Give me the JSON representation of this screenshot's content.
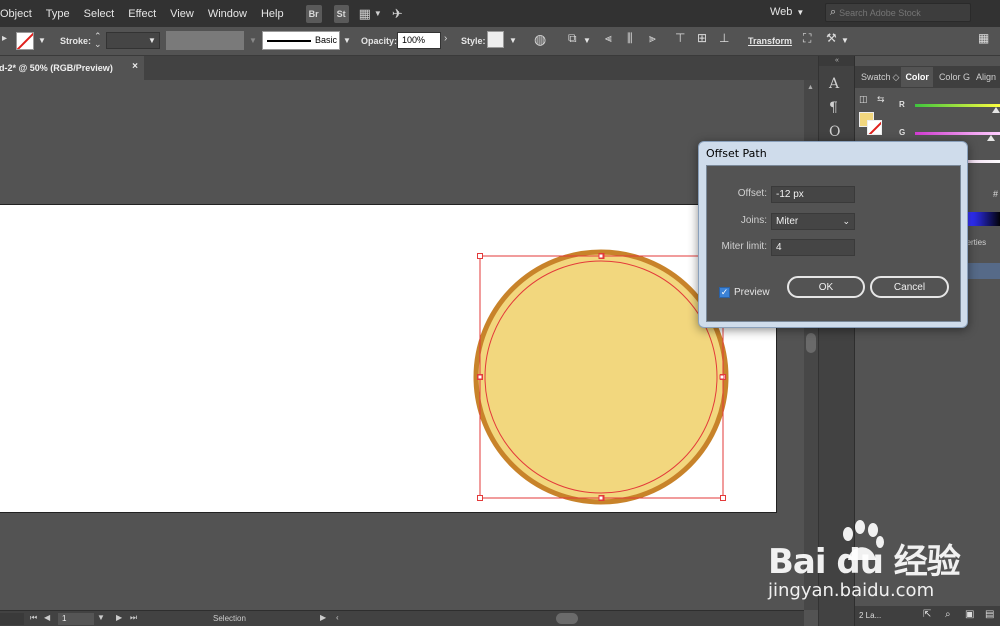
{
  "menubar": {
    "items": [
      "Object",
      "Type",
      "Select",
      "Effect",
      "View",
      "Window",
      "Help"
    ],
    "bridge_label": "Br",
    "stock_label": "St",
    "workspace": "Web",
    "search_placeholder": "Search Adobe Stock"
  },
  "controlbar": {
    "stroke_label": "Stroke:",
    "brush_label": "Basic",
    "opacity_label": "Opacity:",
    "opacity_value": "100%",
    "style_label": "Style:",
    "transform_label": "Transform"
  },
  "document": {
    "tab_title": "d-2* @ 50% (RGB/Preview)",
    "close_glyph": "×"
  },
  "artwork": {
    "fill_color": "#f2d77e",
    "stroke_color": "#c8832a",
    "selection_color": "#e33a3a"
  },
  "panel": {
    "tabs": [
      "Swatch",
      "Color",
      "Color G",
      "Align"
    ],
    "slider_r": "R",
    "slider_g": "G",
    "properties_tab": "roperties",
    "footer": "2 La..."
  },
  "statusbar": {
    "page": "1",
    "tool": "Selection"
  },
  "dialog": {
    "title": "Offset Path",
    "offset_label": "Offset:",
    "offset_value": "-12 px",
    "joins_label": "Joins:",
    "joins_value": "Miter",
    "miter_label": "Miter limit:",
    "miter_value": "4",
    "preview_label": "Preview",
    "preview_checked": true,
    "ok_label": "OK",
    "cancel_label": "Cancel"
  },
  "watermark": {
    "brand": "Bai du 经验",
    "url": "jingyan.baidu.com"
  }
}
